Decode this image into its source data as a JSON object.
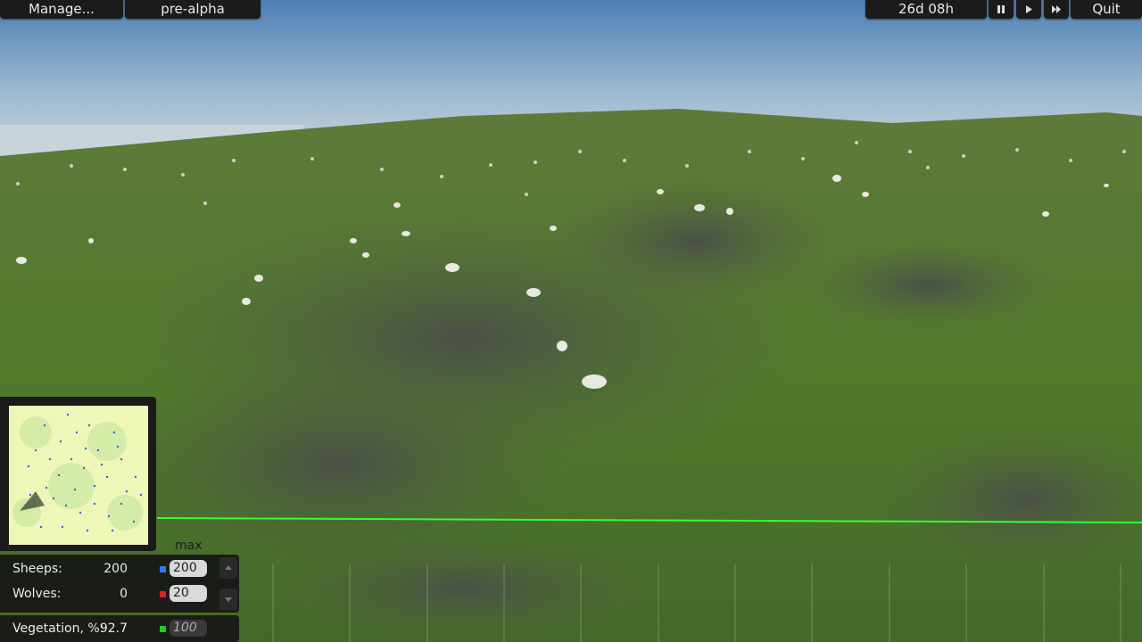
{
  "toolbar": {
    "manage_label": "Manage...",
    "version_label": "pre-alpha",
    "clock_label": "26d 08h",
    "quit_label": "Quit",
    "pause_icon": "pause-icon",
    "play_icon": "play-icon",
    "fast_forward_icon": "fast-forward-icon"
  },
  "stats": {
    "max_header": "max",
    "sheep": {
      "label": "Sheeps:",
      "count": "200",
      "max": "200",
      "color": "#2f7de1"
    },
    "wolves": {
      "label": "Wolves:",
      "count": "0",
      "max": "20",
      "color": "#e02020"
    },
    "vegetation": {
      "label": "Vegetation, %:",
      "value": "92.7",
      "max": "100",
      "color": "#22cc22"
    }
  },
  "colors": {
    "population_line": "#33ff33",
    "minimap_bg": "#eef6b8",
    "sheep_dot": "#2a6ad8"
  }
}
